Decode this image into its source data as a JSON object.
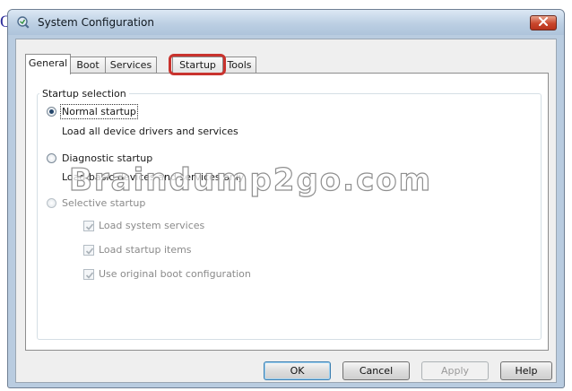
{
  "page_fragment": "Q",
  "window": {
    "title": "System Configuration",
    "icon": "system-config-icon",
    "close_icon": "close-icon"
  },
  "tabs": [
    {
      "label": "General",
      "active": true
    },
    {
      "label": "Boot",
      "active": false
    },
    {
      "label": "Services",
      "active": false
    },
    {
      "label": "Startup",
      "active": false,
      "highlighted": true
    },
    {
      "label": "Tools",
      "active": false
    }
  ],
  "startup_selection": {
    "legend": "Startup selection",
    "normal": {
      "label": "Normal startup",
      "description": "Load all device drivers and services",
      "selected": true
    },
    "diagnostic": {
      "label": "Diagnostic startup",
      "description": "Load basic devices and services only",
      "selected": false
    },
    "selective": {
      "label": "Selective startup",
      "selected": false,
      "disabled": true
    },
    "selective_options": [
      {
        "label": "Load system services",
        "checked": true
      },
      {
        "label": "Load startup items",
        "checked": true
      },
      {
        "label": "Use original boot configuration",
        "checked": true
      }
    ]
  },
  "watermark": "Braindump2go.com",
  "buttons": {
    "ok": "OK",
    "cancel": "Cancel",
    "apply": "Apply",
    "help": "Help"
  },
  "colors": {
    "highlight_border": "#c9332e",
    "window_frame": "#b9cce0",
    "close_button": "#c9462c"
  }
}
